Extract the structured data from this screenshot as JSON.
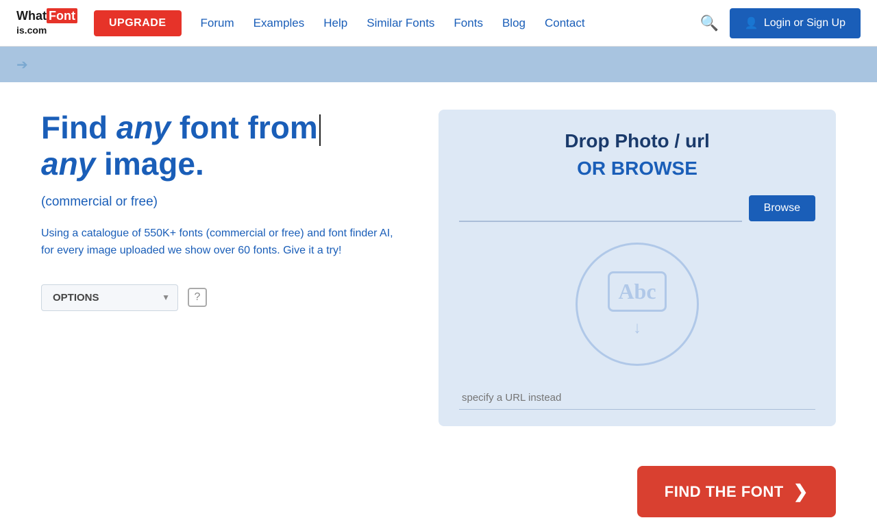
{
  "header": {
    "logo_line1": "What",
    "logo_font": "Font",
    "logo_line2": "is.com",
    "upgrade_label": "UPGRADE",
    "nav_items": [
      {
        "label": "Forum",
        "href": "#"
      },
      {
        "label": "Examples",
        "href": "#"
      },
      {
        "label": "Help",
        "href": "#"
      },
      {
        "label": "Similar Fonts",
        "href": "#"
      },
      {
        "label": "Fonts",
        "href": "#"
      },
      {
        "label": "Blog",
        "href": "#"
      },
      {
        "label": "Contact",
        "href": "#"
      }
    ],
    "login_label": "Login or Sign Up"
  },
  "hero": {
    "headline_part1": "Find ",
    "headline_italic": "any",
    "headline_part2": " font from",
    "headline_line2_italic": "any",
    "headline_line2": " image.",
    "subtitle": "(commercial or free)",
    "description": "Using a catalogue of 550K+ fonts (commercial or free) and font finder AI, for every image uploaded we show over 60 fonts. Give it a try!"
  },
  "options": {
    "label": "OPTIONS",
    "help_icon": "?"
  },
  "upload": {
    "drop_title": "Drop Photo / url",
    "or_browse": "OR BROWSE",
    "browse_btn_label": "Browse",
    "browse_placeholder": "",
    "url_placeholder": "specify a URL instead",
    "abc_label": "Abc"
  },
  "find_font": {
    "label": "FIND THE FONT",
    "arrow": "❯"
  }
}
